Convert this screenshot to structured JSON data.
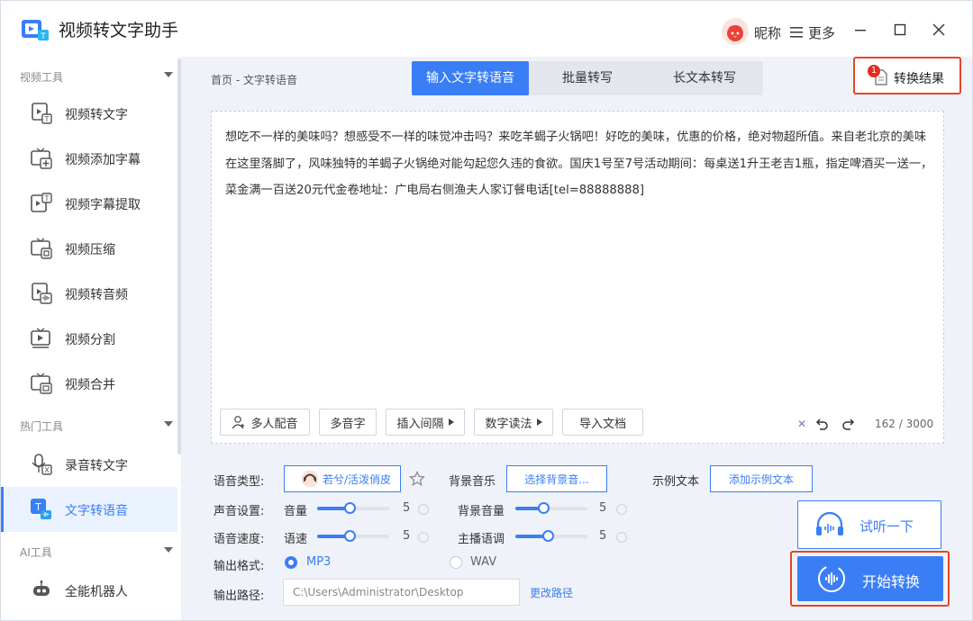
{
  "app": {
    "title": "视频转文字助手",
    "nickname": "昵称",
    "more_label": "更多"
  },
  "sidebar": {
    "sections": [
      {
        "title": "视频工具"
      },
      {
        "title": "热门工具"
      },
      {
        "title": "AI工具"
      }
    ],
    "items": [
      {
        "label": "视频转文字",
        "icon": "video-to-text-icon"
      },
      {
        "label": "视频添加字幕",
        "icon": "add-subtitle-icon"
      },
      {
        "label": "视频字幕提取",
        "icon": "extract-subtitle-icon"
      },
      {
        "label": "视频压缩",
        "icon": "video-compress-icon"
      },
      {
        "label": "视频转音频",
        "icon": "video-to-audio-icon"
      },
      {
        "label": "视频分割",
        "icon": "video-split-icon"
      },
      {
        "label": "视频合并",
        "icon": "video-merge-icon"
      },
      {
        "label": "录音转文字",
        "icon": "recording-to-text-icon"
      },
      {
        "label": "文字转语音",
        "icon": "text-to-speech-icon",
        "active": true
      },
      {
        "label": "全能机器人",
        "icon": "robot-icon"
      }
    ]
  },
  "main": {
    "breadcrumb": "首页 - 文字转语音",
    "tabs": [
      {
        "label": "输入文字转语音",
        "active": true
      },
      {
        "label": "批量转写"
      },
      {
        "label": "长文本转写"
      }
    ],
    "result_button": {
      "label": "转换结果",
      "badge": "1"
    },
    "editor": {
      "text": "想吃不一样的美味吗？想感受不一样的味觉冲击吗？来吃羊蝎子火锅吧！好吃的美味，优惠的价格，绝对物超所值。来自老北京的美味在这里落脚了，风味独特的羊蝎子火锅绝对能勾起您久违的食欲。国庆1号至7号活动期间：每桌送1升王老吉1瓶，指定啤酒买一送一，菜金满一百送20元代金卷地址：广电局右侧渔夫人家订餐电话[tel=88888888]",
      "tools": [
        "多人配音",
        "多音字",
        "插入间隔",
        "数字读法",
        "导入文档"
      ],
      "char_count": "162 / 3000"
    },
    "settings": {
      "voice_type_label": "语音类型:",
      "voice_name": "若兮/活泼俏皮",
      "bgm_label": "背景音乐",
      "bgm_button": "选择背景音...",
      "sample_label": "示例文本",
      "sample_button": "添加示例文本",
      "sound_label": "声音设置:",
      "volume_label": "音量",
      "volume_value": "5",
      "bg_volume_label": "背景音量",
      "bg_volume_value": "5",
      "speed_label": "语音速度:",
      "rate_label": "语速",
      "rate_value": "5",
      "pitch_label": "主播语调",
      "pitch_value": "5",
      "format_label": "输出格式:",
      "format_mp3": "MP3",
      "format_wav": "WAV",
      "selected_format": "MP3",
      "path_label": "输出路径:",
      "path_value": "C:\\Users\\Administrator\\Desktop",
      "change_path": "更改路径"
    },
    "listen_button": "试听一下",
    "start_button": "开始转换"
  },
  "colors": {
    "accent": "#3a7ef6",
    "highlight_border": "#e8432a",
    "badge": "#e8291c"
  }
}
